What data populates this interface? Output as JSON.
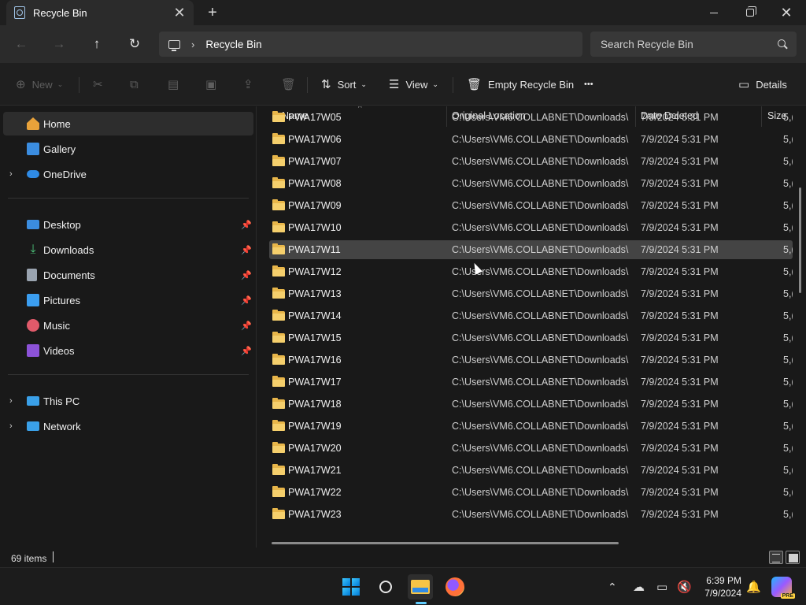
{
  "window": {
    "tab_title": "Recycle Bin",
    "tab_close": "✕",
    "new_tab": "+",
    "minimize": "",
    "maximize": "",
    "close": "✕"
  },
  "nav": {
    "back": "←",
    "forward": "→",
    "up": "↑",
    "refresh": "↻",
    "breadcrumb": "Recycle Bin",
    "search_placeholder": "Search Recycle Bin"
  },
  "toolbar": {
    "new_label": "New",
    "sort_label": "Sort",
    "view_label": "View",
    "empty_label": "Empty Recycle Bin",
    "more_label": "•••",
    "details_label": "Details"
  },
  "sidebar": {
    "items": [
      {
        "label": "Home",
        "icon": "home-icon",
        "color": "#e8a23a"
      },
      {
        "label": "Gallery",
        "icon": "gallery-icon",
        "color": "#3b8de0"
      },
      {
        "label": "OneDrive",
        "icon": "onedrive-icon",
        "color": "#2f8be6"
      },
      {
        "label": "Desktop",
        "icon": "desktop-icon",
        "color": "#3b8de0"
      },
      {
        "label": "Downloads",
        "icon": "download-icon",
        "color": "#4cc27a"
      },
      {
        "label": "Documents",
        "icon": "documents-icon",
        "color": "#9aa4b0"
      },
      {
        "label": "Pictures",
        "icon": "pictures-icon",
        "color": "#3b9ef0"
      },
      {
        "label": "Music",
        "icon": "music-icon",
        "color": "#e05a6a"
      },
      {
        "label": "Videos",
        "icon": "videos-icon",
        "color": "#8c52d8"
      },
      {
        "label": "This PC",
        "icon": "pc-icon",
        "color": "#3aa0e8"
      },
      {
        "label": "Network",
        "icon": "network-icon",
        "color": "#3aa0e8"
      }
    ]
  },
  "columns": {
    "name": "Name",
    "location": "Original Location",
    "date": "Date Deleted",
    "size": "Size"
  },
  "files": [
    {
      "name": "PWA17W05",
      "location": "C:\\Users\\VM6.COLLABNET\\Downloads\\...",
      "date": "7/9/2024 5:31 PM",
      "size": "5,("
    },
    {
      "name": "PWA17W06",
      "location": "C:\\Users\\VM6.COLLABNET\\Downloads\\...",
      "date": "7/9/2024 5:31 PM",
      "size": "5,("
    },
    {
      "name": "PWA17W07",
      "location": "C:\\Users\\VM6.COLLABNET\\Downloads\\...",
      "date": "7/9/2024 5:31 PM",
      "size": "5,("
    },
    {
      "name": "PWA17W08",
      "location": "C:\\Users\\VM6.COLLABNET\\Downloads\\...",
      "date": "7/9/2024 5:31 PM",
      "size": "5,("
    },
    {
      "name": "PWA17W09",
      "location": "C:\\Users\\VM6.COLLABNET\\Downloads\\...",
      "date": "7/9/2024 5:31 PM",
      "size": "5,("
    },
    {
      "name": "PWA17W10",
      "location": "C:\\Users\\VM6.COLLABNET\\Downloads\\...",
      "date": "7/9/2024 5:31 PM",
      "size": "5,("
    },
    {
      "name": "PWA17W11",
      "location": "C:\\Users\\VM6.COLLABNET\\Downloads\\...",
      "date": "7/9/2024 5:31 PM",
      "size": "5,("
    },
    {
      "name": "PWA17W12",
      "location": "C:\\Users\\VM6.COLLABNET\\Downloads\\...",
      "date": "7/9/2024 5:31 PM",
      "size": "5,("
    },
    {
      "name": "PWA17W13",
      "location": "C:\\Users\\VM6.COLLABNET\\Downloads\\...",
      "date": "7/9/2024 5:31 PM",
      "size": "5,("
    },
    {
      "name": "PWA17W14",
      "location": "C:\\Users\\VM6.COLLABNET\\Downloads\\...",
      "date": "7/9/2024 5:31 PM",
      "size": "5,("
    },
    {
      "name": "PWA17W15",
      "location": "C:\\Users\\VM6.COLLABNET\\Downloads\\...",
      "date": "7/9/2024 5:31 PM",
      "size": "5,("
    },
    {
      "name": "PWA17W16",
      "location": "C:\\Users\\VM6.COLLABNET\\Downloads\\...",
      "date": "7/9/2024 5:31 PM",
      "size": "5,("
    },
    {
      "name": "PWA17W17",
      "location": "C:\\Users\\VM6.COLLABNET\\Downloads\\...",
      "date": "7/9/2024 5:31 PM",
      "size": "5,("
    },
    {
      "name": "PWA17W18",
      "location": "C:\\Users\\VM6.COLLABNET\\Downloads\\...",
      "date": "7/9/2024 5:31 PM",
      "size": "5,("
    },
    {
      "name": "PWA17W19",
      "location": "C:\\Users\\VM6.COLLABNET\\Downloads\\...",
      "date": "7/9/2024 5:31 PM",
      "size": "5,("
    },
    {
      "name": "PWA17W20",
      "location": "C:\\Users\\VM6.COLLABNET\\Downloads\\...",
      "date": "7/9/2024 5:31 PM",
      "size": "5,("
    },
    {
      "name": "PWA17W21",
      "location": "C:\\Users\\VM6.COLLABNET\\Downloads\\...",
      "date": "7/9/2024 5:31 PM",
      "size": "5,("
    },
    {
      "name": "PWA17W22",
      "location": "C:\\Users\\VM6.COLLABNET\\Downloads\\...",
      "date": "7/9/2024 5:31 PM",
      "size": "5,("
    },
    {
      "name": "PWA17W23",
      "location": "C:\\Users\\VM6.COLLABNET\\Downloads\\...",
      "date": "7/9/2024 5:31 PM",
      "size": "5,("
    }
  ],
  "selected_file": "PWA17W11",
  "status": {
    "item_count": "69 items"
  },
  "taskbar": {
    "time": "6:39 PM",
    "date": "7/9/2024",
    "copilot_badge": "PRE"
  },
  "colors": {
    "accent": "#60cdff",
    "folder": "#e8b64a",
    "background": "#191919"
  }
}
